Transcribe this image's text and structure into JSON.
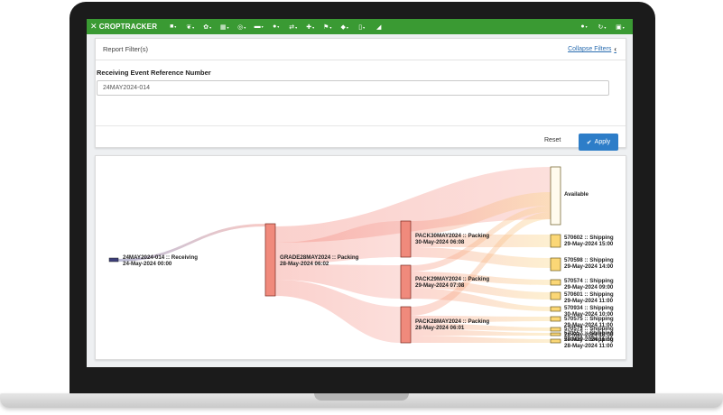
{
  "app": {
    "brand_name": "CROPTRACKER",
    "nav_icons": [
      "bookmark-icon",
      "leaf-icon",
      "sprout-icon",
      "grid-icon",
      "target-icon",
      "truck-icon",
      "user-icon",
      "swap-icon",
      "pin-icon",
      "flag-icon",
      "lightbulb-icon",
      "phone-icon",
      "chart-icon"
    ],
    "right_icons": [
      "help-icon",
      "refresh-icon",
      "account-icon"
    ],
    "brand_color": "#3a9a33"
  },
  "filter": {
    "title": "Report Filter(s)",
    "collapse_label": "Collapse Filters",
    "field_label": "Receiving Event Reference Number",
    "field_value": "24MAY2024-014",
    "reset_label": "Reset",
    "apply_label": "Apply",
    "apply_color": "#2d7dc8"
  },
  "sankey": {
    "nodes": [
      {
        "id": "recv",
        "line1": "24MAY2024-014 :: Receiving",
        "line2": "24-May-2024 00:00"
      },
      {
        "id": "grade",
        "line1": "GRADE28MAY2024 :: Packing",
        "line2": "28-May-2024 06:02"
      },
      {
        "id": "pack30",
        "line1": "PACK30MAY2024 :: Packing",
        "line2": "30-May-2024 06:08"
      },
      {
        "id": "pack29",
        "line1": "PACK29MAY2024 :: Packing",
        "line2": "29-May-2024 07:08"
      },
      {
        "id": "pack28",
        "line1": "PACK28MAY2024 :: Packing",
        "line2": "28-May-2024 06:01"
      },
      {
        "id": "avail",
        "line1": "Available",
        "line2": ""
      },
      {
        "id": "s602",
        "line1": "570602 :: Shipping",
        "line2": "29-May-2024 15:00"
      },
      {
        "id": "s598",
        "line1": "570598 :: Shipping",
        "line2": "29-May-2024 14:00"
      },
      {
        "id": "s574",
        "line1": "570574 :: Shipping",
        "line2": "29-May-2024 09:00"
      },
      {
        "id": "s601",
        "line1": "570601 :: Shipping",
        "line2": "29-May-2024 11:00"
      },
      {
        "id": "s934",
        "line1": "570934 :: Shipping",
        "line2": "30-May-2024 10:00"
      },
      {
        "id": "s575",
        "line1": "570575 :: Shipping",
        "line2": "29-May-2024 11:00"
      },
      {
        "id": "s573",
        "line1": "570573 :: Shipping",
        "line2": "28-May-2024 18:00"
      },
      {
        "id": "s557",
        "line1": "570557 :: Shipping",
        "line2": "28-May-2024 11:00"
      },
      {
        "id": "s429",
        "line1": "570429 :: Shipping",
        "line2": "28-May-2024 11:00"
      }
    ]
  }
}
